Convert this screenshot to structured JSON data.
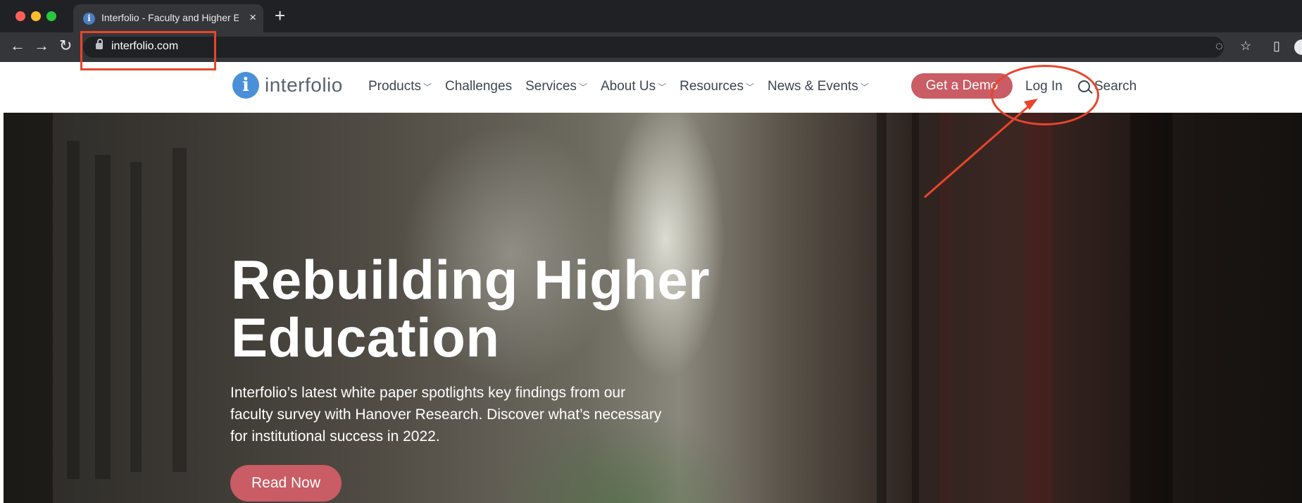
{
  "browser": {
    "tab_title": "Interfolio - Faculty and Higher E",
    "tab_close": "×",
    "new_tab": "+",
    "url": "interfolio.com",
    "back": "←",
    "forward": "→",
    "reload": "↻",
    "eye_off": "◌",
    "bookmark_star": "☆",
    "side_panel": "▯"
  },
  "site": {
    "logo_mark": "i",
    "logo_text": "interfolio",
    "nav": [
      {
        "label": "Products",
        "chevron": "﹀"
      },
      {
        "label": "Challenges",
        "chevron": ""
      },
      {
        "label": "Services",
        "chevron": "﹀"
      },
      {
        "label": "About Us",
        "chevron": "﹀"
      },
      {
        "label": "Resources",
        "chevron": "﹀"
      },
      {
        "label": "News & Events",
        "chevron": "﹀"
      }
    ],
    "demo_button": "Get a Demo",
    "login": "Log In",
    "search": "Search"
  },
  "hero": {
    "title_line1": "Rebuilding Higher",
    "title_line2": "Education",
    "subtitle_line1": "Interfolio’s latest white paper spotlights key findings from our",
    "subtitle_line2": "faculty survey with Hanover Research. Discover what’s necessary",
    "subtitle_line3": "for institutional success in 2022.",
    "cta": "Read Now"
  },
  "colors": {
    "annotation": "#e8452c",
    "brand_button": "#c95c64",
    "logo_blue": "#4a90d9"
  }
}
